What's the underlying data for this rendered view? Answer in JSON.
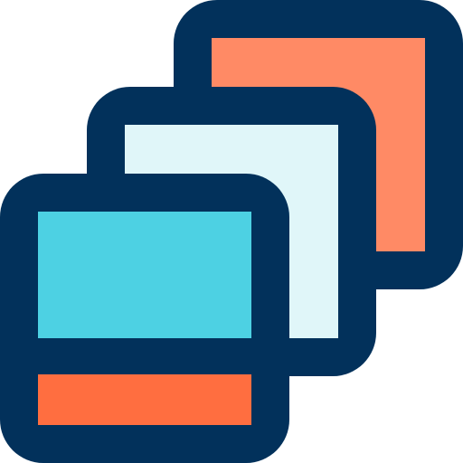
{
  "icon": {
    "name": "stacked-layers-icon",
    "colors": {
      "outline": "#02315B",
      "back_fill": "#FF8A65",
      "middle_fill": "#E0F6F9",
      "front_top_fill": "#4DD1E3",
      "front_bottom_fill": "#FF6E40",
      "background": "#FFFFFF"
    }
  }
}
